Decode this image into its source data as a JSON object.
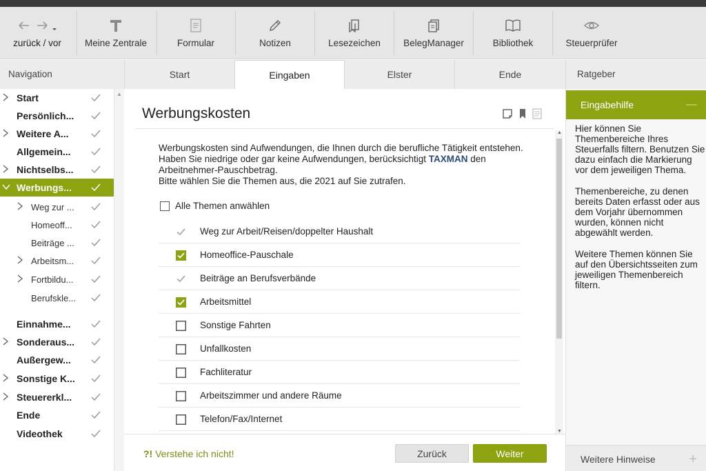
{
  "toolbar": {
    "back_forward_label": "zurück / vor",
    "items": [
      {
        "label": "Meine Zentrale",
        "icon": "text-t-icon"
      },
      {
        "label": "Formular",
        "icon": "form-icon"
      },
      {
        "label": "Notizen",
        "icon": "pencil-icon"
      },
      {
        "label": "Lesezeichen",
        "icon": "bookmarks-icon"
      },
      {
        "label": "BelegManager",
        "icon": "documents-icon"
      },
      {
        "label": "Bibliothek",
        "icon": "book-icon"
      },
      {
        "label": "Steuerprüfer",
        "icon": "eye-icon"
      }
    ]
  },
  "navigation_header": "Navigation",
  "tabs": [
    {
      "label": "Start",
      "active": false
    },
    {
      "label": "Eingaben",
      "active": true
    },
    {
      "label": "Elster",
      "active": false
    },
    {
      "label": "Ende",
      "active": false
    }
  ],
  "ratgeber_header": "Ratgeber",
  "sidebar": {
    "items": [
      {
        "label": "Start",
        "level": 1,
        "expandable": true
      },
      {
        "label": "Persönlich...",
        "level": 1,
        "expandable": false
      },
      {
        "label": "Weitere A...",
        "level": 1,
        "expandable": true
      },
      {
        "label": "Allgemein...",
        "level": 1,
        "expandable": false
      },
      {
        "label": "Nichtselbs...",
        "level": 1,
        "expandable": true
      },
      {
        "label": "Werbungs...",
        "level": 1,
        "expandable": true,
        "active": true
      },
      {
        "label": "Weg zur ...",
        "level": 2,
        "expandable": true
      },
      {
        "label": "Homeoff...",
        "level": 2,
        "expandable": false
      },
      {
        "label": "Beiträge ...",
        "level": 2,
        "expandable": false
      },
      {
        "label": "Arbeitsm...",
        "level": 2,
        "expandable": true
      },
      {
        "label": "Fortbildu...",
        "level": 2,
        "expandable": true
      },
      {
        "label": "Berufskle...",
        "level": 2,
        "expandable": false
      },
      {
        "label": "Einnahme...",
        "level": 1,
        "expandable": false
      },
      {
        "label": "Sonderaus...",
        "level": 1,
        "expandable": true
      },
      {
        "label": "Außergew...",
        "level": 1,
        "expandable": false
      },
      {
        "label": "Sonstige K...",
        "level": 1,
        "expandable": true
      },
      {
        "label": "Steuererkl...",
        "level": 1,
        "expandable": true
      },
      {
        "label": "Ende",
        "level": 1,
        "expandable": false
      },
      {
        "label": "Videothek",
        "level": 1,
        "expandable": false
      }
    ]
  },
  "main": {
    "title": "Werbungskosten",
    "intro_part1": "Werbungskosten sind Aufwendungen, die Ihnen durch die berufliche Tätigkeit entstehen. Haben Sie niedrige oder gar keine Aufwendungen, berücksichtigt ",
    "intro_brand": "TAXMAN",
    "intro_part2": " den Arbeitnehmer-Pauschbetrag.",
    "intro_line2": "Bitte wählen Sie die Themen aus, die 2021 auf Sie zutrafen.",
    "select_all_label": "Alle Themen anwählen",
    "topics": [
      {
        "label": "Weg zur Arbeit/Reisen/doppelter Haushalt",
        "state": "checked-disabled"
      },
      {
        "label": "Homeoffice-Pauschale",
        "state": "checked"
      },
      {
        "label": "Beiträge an Berufsverbände",
        "state": "checked-disabled"
      },
      {
        "label": "Arbeitsmittel",
        "state": "checked"
      },
      {
        "label": "Sonstige Fahrten",
        "state": "unchecked"
      },
      {
        "label": "Unfallkosten",
        "state": "unchecked"
      },
      {
        "label": "Fachliteratur",
        "state": "unchecked"
      },
      {
        "label": "Arbeitszimmer und andere Räume",
        "state": "unchecked"
      },
      {
        "label": "Telefon/Fax/Internet",
        "state": "unchecked"
      }
    ],
    "help_link_prefix": "?!",
    "help_link_text": " Verstehe ich nicht!",
    "back_button": "Zurück",
    "next_button": "Weiter"
  },
  "right_panel": {
    "eingabehilfe_title": "Eingabehilfe",
    "paragraphs": [
      "Hier können Sie Themenbereiche Ihres Steuerfalls filtern. Benutzen Sie dazu einfach die Markierung vor dem jeweiligen Thema.",
      "Themenbereiche, zu denen bereits Daten erfasst oder aus dem Vorjahr übernommen wurden, können nicht abgewählt werden.",
      "Weitere Themen können Sie auf den Übersichtsseiten zum jeweiligen Themenbereich filtern."
    ],
    "footer_title": "Weitere Hinweise"
  },
  "colors": {
    "accent": "#8fa311",
    "brand_text": "#2b4a7a",
    "disabled_check": "#aaaaaa"
  }
}
